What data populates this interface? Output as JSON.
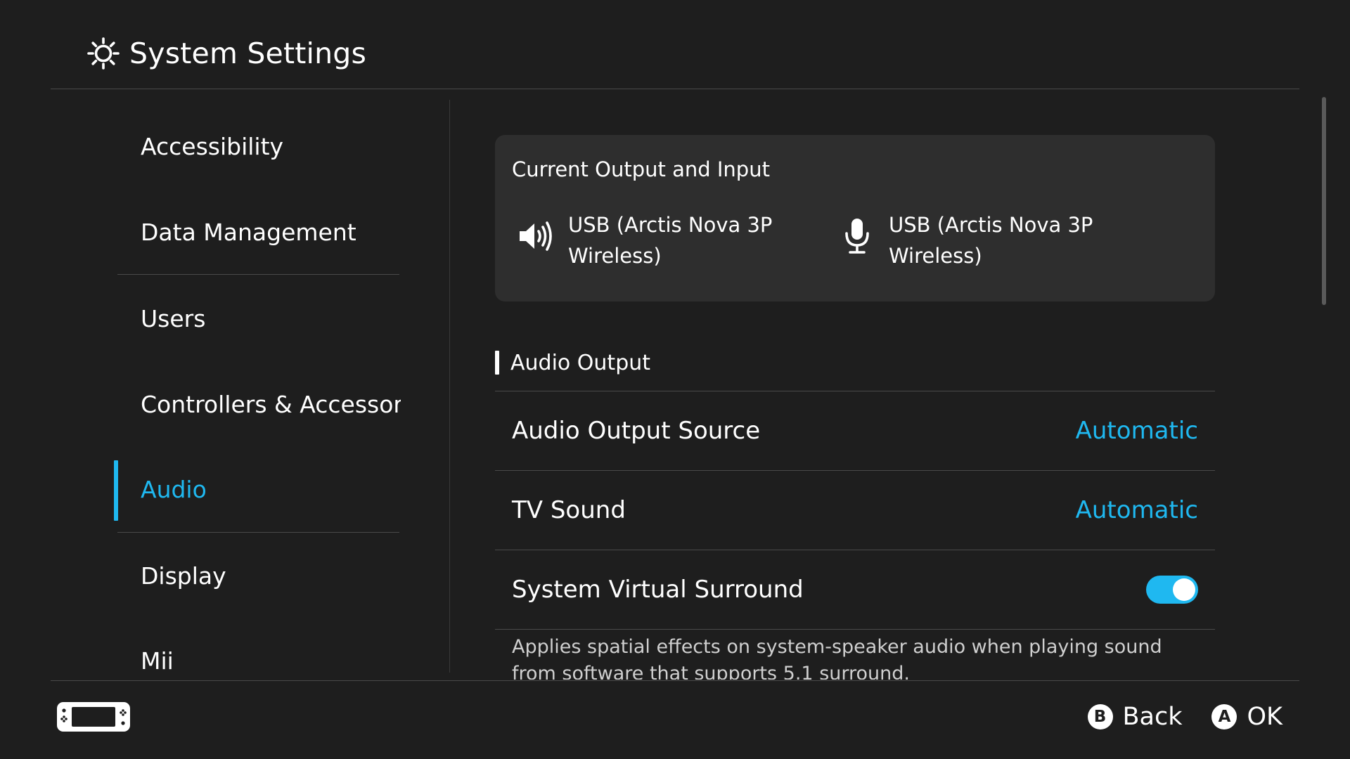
{
  "header": {
    "title": "System Settings",
    "icon": "gear-icon"
  },
  "sidebar": {
    "items": [
      {
        "label": "Accessibility",
        "active": false
      },
      {
        "label": "Data Management",
        "active": false
      },
      {
        "label": "Users",
        "active": false
      },
      {
        "label": "Controllers & Accessories",
        "active": false
      },
      {
        "label": "Audio",
        "active": true
      },
      {
        "label": "Display",
        "active": false
      },
      {
        "label": "Mii",
        "active": false
      }
    ]
  },
  "io_card": {
    "title": "Current Output and Input",
    "output": {
      "icon": "speaker-icon",
      "device": "USB (Arctis Nova 3P Wireless)"
    },
    "input": {
      "icon": "microphone-icon",
      "device": "USB (Arctis Nova 3P Wireless)"
    }
  },
  "audio_output": {
    "section_title": "Audio Output",
    "rows": [
      {
        "label": "Audio Output Source",
        "value": "Automatic"
      },
      {
        "label": "TV Sound",
        "value": "Automatic"
      },
      {
        "label": "System Virtual Surround",
        "toggle": true
      }
    ],
    "description": "Applies spatial effects on system-speaker audio when playing sound from software that supports 5.1 surround."
  },
  "footer": {
    "back": {
      "key": "B",
      "label": "Back"
    },
    "ok": {
      "key": "A",
      "label": "OK"
    }
  },
  "colors": {
    "background": "#1e1e1e",
    "accent": "#1fb8f0",
    "card": "#2e2e2e",
    "separator": "#4a4a4a"
  }
}
